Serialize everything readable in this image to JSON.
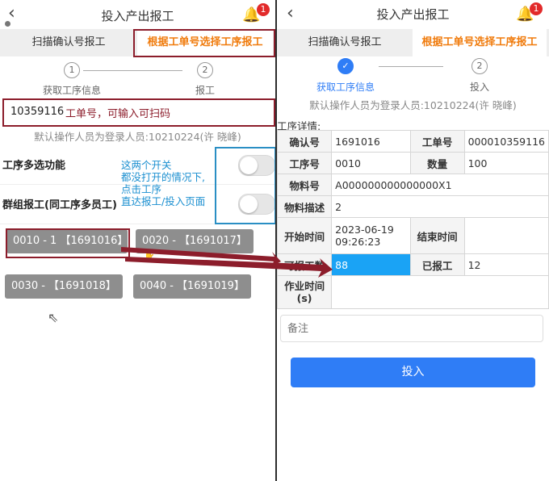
{
  "left": {
    "header": {
      "title": "投入产出报工",
      "badge": "1"
    },
    "tabs": [
      {
        "label": "扫描确认号报工"
      },
      {
        "label": "根据工单号选择工序报工"
      }
    ],
    "steps": [
      {
        "num": "1",
        "label": "获取工序信息"
      },
      {
        "num": "2",
        "label": "报工"
      }
    ],
    "work_order_input": {
      "value": "10359116",
      "annotation": "工单号，可输入可扫码"
    },
    "operator_text": "默认操作人员为登录人员:10210224(许 晓峰)",
    "switches": [
      {
        "label": "工序多选功能",
        "on": false
      },
      {
        "label": "群组报工(同工序多员工)",
        "on": false
      }
    ],
    "switch_annotation": [
      "这两个开关",
      "都没打开的情况下,",
      "点击工序",
      "直达报工/投入页面"
    ],
    "processes": [
      {
        "label": "0010 - 1 【1691016】"
      },
      {
        "label": "0020 - 【1691017】"
      },
      {
        "label": "0030 - 【1691018】"
      },
      {
        "label": "0040 - 【1691019】"
      }
    ]
  },
  "right": {
    "header": {
      "title": "投入产出报工",
      "badge": "1"
    },
    "tabs": [
      {
        "label": "扫描确认号报工"
      },
      {
        "label": "根据工单号选择工序报工"
      }
    ],
    "steps": [
      {
        "label": "获取工序信息"
      },
      {
        "num": "2",
        "label": "投入"
      }
    ],
    "operator_text": "默认操作人员为登录人员:10210224(许 晓峰)",
    "details_title": "工序详情:",
    "details": {
      "confirm_no_label": "确认号",
      "confirm_no": "1691016",
      "order_no_label": "工单号",
      "order_no": "000010359116",
      "op_no_label": "工序号",
      "op_no": "0010",
      "qty_label": "数量",
      "qty": "100",
      "material_label": "物料号",
      "material": "A000000000000000X1",
      "desc_label": "物料描述",
      "desc": "2",
      "start_label": "开始时间",
      "start": "2023-06-19 09:26:23",
      "end_label": "结束时间",
      "end": "",
      "reportable_label": "可报工数",
      "reportable": "88",
      "reported_label": "已报工",
      "reported": "12",
      "work_time_label": "作业时间(s)",
      "work_time": ""
    },
    "remarks_placeholder": "备注",
    "submit_label": "投入"
  }
}
